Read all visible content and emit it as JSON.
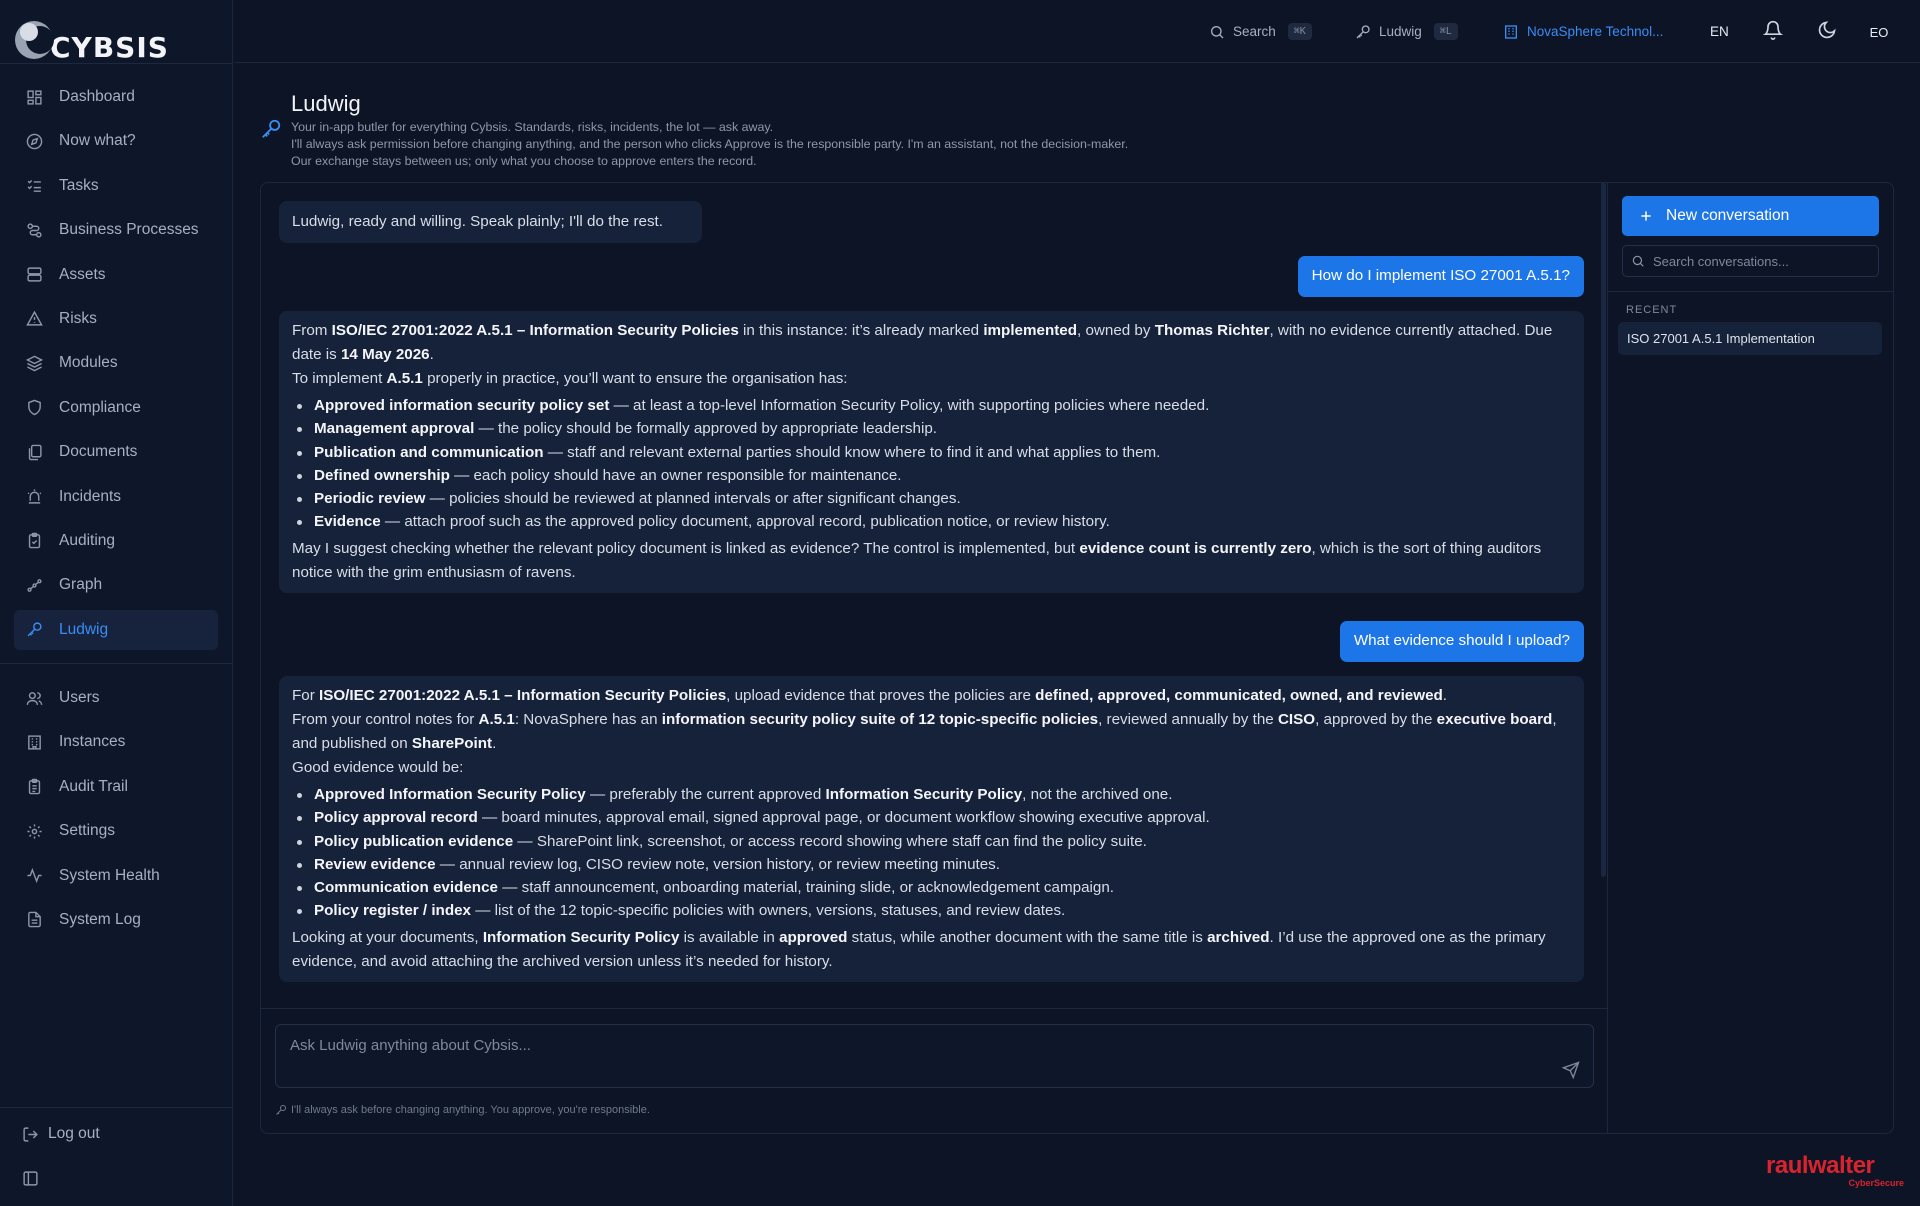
{
  "app": {
    "name": "CYBSIS"
  },
  "sidebar": {
    "items": [
      {
        "label": "Dashboard",
        "icon": "dashboard-icon"
      },
      {
        "label": "Now what?",
        "icon": "compass-icon"
      },
      {
        "label": "Tasks",
        "icon": "checklist-icon"
      },
      {
        "label": "Business Processes",
        "icon": "workflow-icon"
      },
      {
        "label": "Assets",
        "icon": "server-icon"
      },
      {
        "label": "Risks",
        "icon": "warning-icon"
      },
      {
        "label": "Modules",
        "icon": "layers-icon"
      },
      {
        "label": "Compliance",
        "icon": "shield-icon"
      },
      {
        "label": "Documents",
        "icon": "documents-icon"
      },
      {
        "label": "Incidents",
        "icon": "siren-icon"
      },
      {
        "label": "Auditing",
        "icon": "clipboard-check-icon"
      },
      {
        "label": "Graph",
        "icon": "graph-icon"
      },
      {
        "label": "Ludwig",
        "icon": "key-icon",
        "active": true
      }
    ],
    "admin_items": [
      {
        "label": "Users",
        "icon": "users-icon"
      },
      {
        "label": "Instances",
        "icon": "building-icon"
      },
      {
        "label": "Audit Trail",
        "icon": "clipboard-list-icon"
      },
      {
        "label": "Settings",
        "icon": "gear-icon"
      },
      {
        "label": "System Health",
        "icon": "activity-icon"
      },
      {
        "label": "System Log",
        "icon": "file-text-icon"
      }
    ],
    "logout": "Log out"
  },
  "header": {
    "search": {
      "label": "Search",
      "shortcut": "⌘K"
    },
    "assistant": {
      "label": "Ludwig",
      "shortcut": "⌘L"
    },
    "organization": "NovaSphere Technol...",
    "language": "EN",
    "user_initials": "EO"
  },
  "page": {
    "title": "Ludwig",
    "subtitle_lines": [
      "Your in-app butler for everything Cybsis. Standards, risks, incidents, the lot — ask away.",
      "I'll always ask permission before changing anything, and the person who clicks Approve is the responsible party. I'm an assistant, not the decision-maker.",
      "Our exchange stays between us; only what you choose to approve enters the record."
    ]
  },
  "chat": {
    "greeting": "Ludwig, ready and willing. Speak plainly; I'll do the rest.",
    "user_messages": [
      "How do I implement ISO 27001 A.5.1?",
      "What evidence should I upload?"
    ],
    "reply1": {
      "intro_html": "From <b>ISO/IEC 27001:2022 A.5.1 – Information Security Policies</b> in this instance: it’s already marked <b>implemented</b>, owned by <b>Thomas Richter</b>, with no evidence currently attached. Due date is <b>14 May 2026</b>.",
      "lead_html": "To implement <b>A.5.1</b> properly in practice, you’ll want to ensure the organisation has:",
      "bullets": [
        {
          "term": "Approved information security policy set",
          "text": " — at least a top-level Information Security Policy, with supporting policies where needed."
        },
        {
          "term": "Management approval",
          "text": " — the policy should be formally approved by appropriate leadership."
        },
        {
          "term": "Publication and communication",
          "text": " — staff and relevant external parties should know where to find it and what applies to them."
        },
        {
          "term": "Defined ownership",
          "text": " — each policy should have an owner responsible for maintenance."
        },
        {
          "term": "Periodic review",
          "text": " — policies should be reviewed at planned intervals or after significant changes."
        },
        {
          "term": "Evidence",
          "text": " — attach proof such as the approved policy document, approval record, publication notice, or review history."
        }
      ],
      "closing_html": "May I suggest checking whether the relevant policy document is linked as evidence? The control is implemented, but <b>evidence count is currently zero</b>, which is the sort of thing auditors notice with the grim enthusiasm of ravens."
    },
    "reply2": {
      "intro_html": "For <b>ISO/IEC 27001:2022 A.5.1 – Information Security Policies</b>, upload evidence that proves the policies are <b>defined, approved, communicated, owned, and reviewed</b>.",
      "notes_html": "From your control notes for <b>A.5.1</b>: NovaSphere has an <b>information security policy suite of 12 topic-specific policies</b>, reviewed annually by the <b>CISO</b>, approved by the <b>executive board</b>, and published on <b>SharePoint</b>.",
      "lead_html": "Good evidence would be:",
      "bullets": [
        {
          "term": "Approved Information Security Policy",
          "text_html": " — preferably the current approved <b>Information Security Policy</b>, not the archived one."
        },
        {
          "term": "Policy approval record",
          "text_html": " — board minutes, approval email, signed approval page, or document workflow showing executive approval."
        },
        {
          "term": "Policy publication evidence",
          "text_html": " — SharePoint link, screenshot, or access record showing where staff can find the policy suite."
        },
        {
          "term": "Review evidence",
          "text_html": " — annual review log, CISO review note, version history, or review meeting minutes."
        },
        {
          "term": "Communication evidence",
          "text_html": " — staff announcement, onboarding material, training slide, or acknowledgement campaign."
        },
        {
          "term": "Policy register / index",
          "text_html": " — list of the 12 topic-specific policies with owners, versions, statuses, and review dates."
        }
      ],
      "closing_html": "Looking at your documents, <b>Information Security Policy</b> is available in <b>approved</b> status, while another document with the same title is <b>archived</b>. I’d use the approved one as the primary evidence, and avoid attaching the archived version unless it’s needed for history."
    },
    "composer_placeholder": "Ask Ludwig anything about Cybsis...",
    "disclaimer": "I'll always ask before changing anything. You approve, you're responsible."
  },
  "conversations": {
    "new_label": "New conversation",
    "search_placeholder": "Search conversations...",
    "recent_label": "RECENT",
    "items": [
      "ISO 27001 A.5.1 Implementation"
    ]
  },
  "brand": {
    "name": "raulwalter",
    "tagline": "CyberSecure"
  },
  "colors": {
    "background": "#0c1426",
    "accent": "#1d76e8",
    "active_link": "#3b8cf3",
    "brand_red": "#d9232d"
  }
}
